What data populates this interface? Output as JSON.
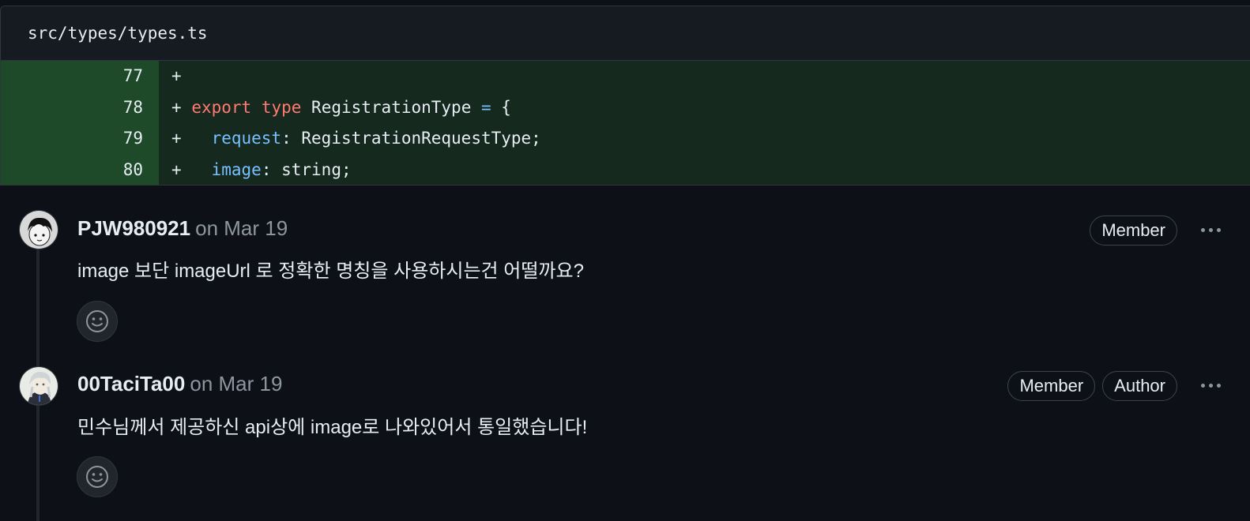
{
  "file": {
    "path": "src/types/types.ts",
    "lines": [
      {
        "num": "77",
        "marker": "+",
        "code": ""
      },
      {
        "num": "78",
        "marker": "+",
        "code": "export type RegistrationType = {"
      },
      {
        "num": "79",
        "marker": "+",
        "code": "  request: RegistrationRequestType;"
      },
      {
        "num": "80",
        "marker": "+",
        "code": "  image: string;"
      }
    ]
  },
  "comments": [
    {
      "author": "PJW980921",
      "date": "on Mar 19",
      "body": "image 보단 imageUrl 로 정확한 명칭을 사용하시는건 어떨까요?",
      "badges": [
        "Member"
      ]
    },
    {
      "author": "00TaciTa00",
      "date": "on Mar 19",
      "body": "민수님께서 제공하신 api상에 image로 나와있어서 통일했습니다!",
      "badges": [
        "Member",
        "Author"
      ]
    }
  ],
  "icons": {
    "more": "kebab-horizontal-icon",
    "reaction": "smiley-icon"
  },
  "colors": {
    "background": "#0d1117",
    "diff_added_line": "#16291e",
    "diff_added_gutter": "#1f4a2a",
    "keyword": "#ff7b72",
    "property": "#79c0ff",
    "muted": "#8d96a0"
  }
}
